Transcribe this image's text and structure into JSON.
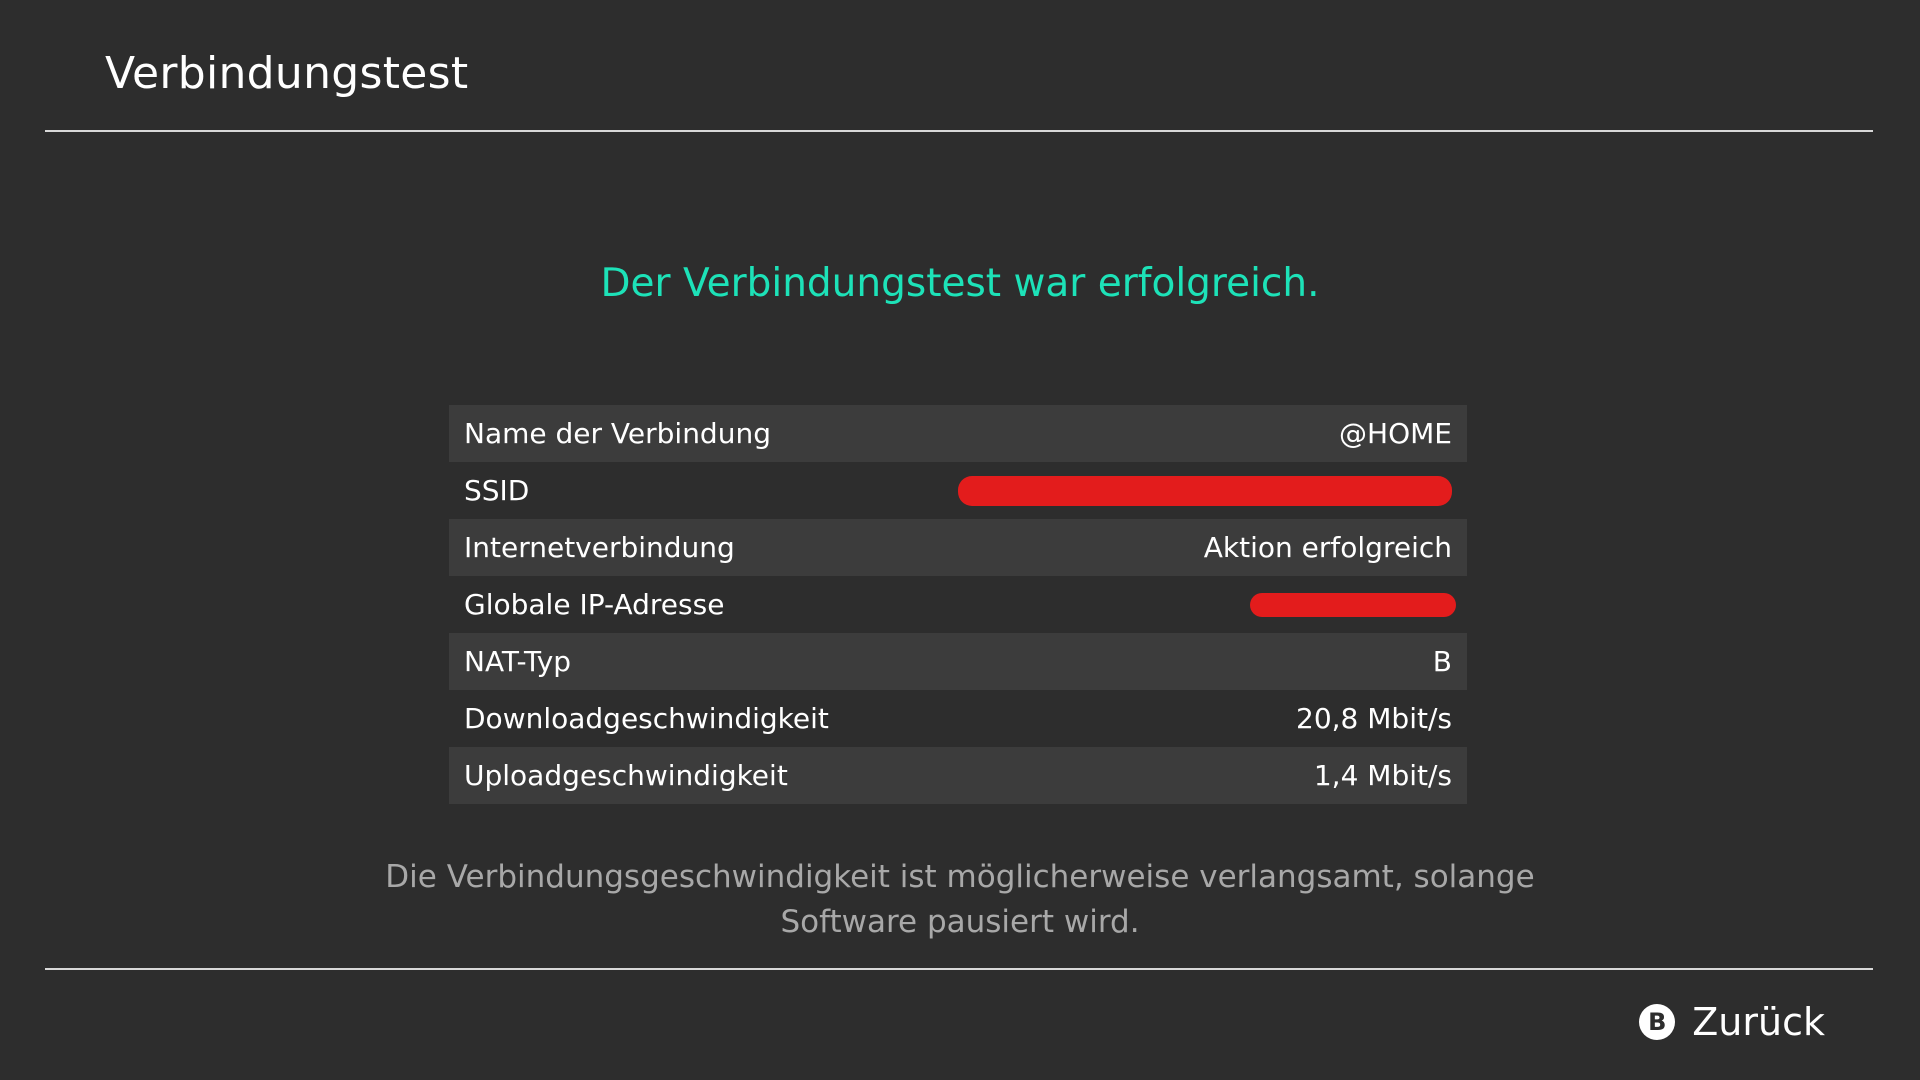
{
  "header": {
    "title": "Verbindungstest"
  },
  "status": {
    "message": "Der Verbindungstest war erfolgreich.",
    "color": "#1de2b8"
  },
  "results": [
    {
      "label": "Name der Verbindung",
      "value": "@HOME"
    },
    {
      "label": "SSID",
      "value": null,
      "redacted": true
    },
    {
      "label": "Internetverbindung",
      "value": "Aktion erfolgreich"
    },
    {
      "label": "Globale IP-Adresse",
      "value": null,
      "redacted": true
    },
    {
      "label": "NAT-Typ",
      "value": "B"
    },
    {
      "label": "Downloadgeschwindigkeit",
      "value": "20,8 Mbit/s"
    },
    {
      "label": "Uploadgeschwindigkeit",
      "value": "1,4 Mbit/s"
    }
  ],
  "note": {
    "line1": "Die Verbindungsgeschwindigkeit ist möglicherweise verlangsamt, solange",
    "line2": "Software pausiert wird."
  },
  "footer": {
    "back_icon_letter": "B",
    "back_label": "Zurück"
  },
  "colors": {
    "background": "#2d2d2d",
    "row_shade": "#3c3c3c",
    "redaction": "#e31c1c"
  }
}
